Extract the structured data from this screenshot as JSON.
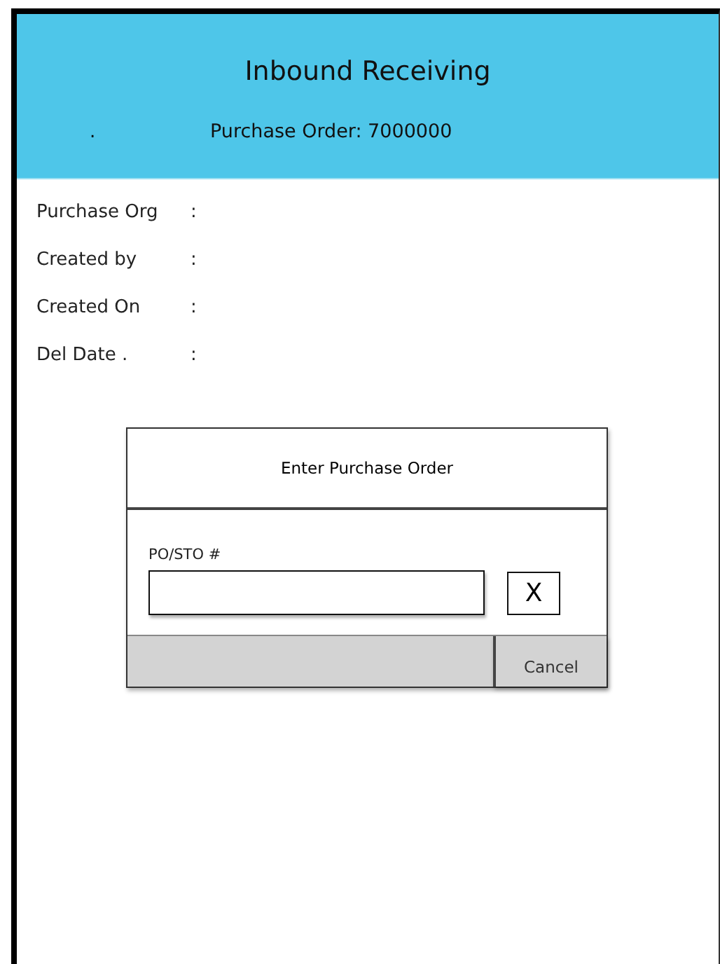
{
  "header": {
    "title": "Inbound Receiving",
    "dot": ".",
    "subtitle": "Purchase Order: 7000000"
  },
  "fields": [
    {
      "label": "Purchase Org",
      "colon": ":"
    },
    {
      "label": "Created by",
      "colon": ":"
    },
    {
      "label": "Created On",
      "colon": ":"
    },
    {
      "label": "Del Date .",
      "colon": ":"
    }
  ],
  "dialog": {
    "title": "Enter Purchase Order",
    "field_label": "PO/STO #",
    "clear": "X",
    "cancel": "Cancel"
  }
}
